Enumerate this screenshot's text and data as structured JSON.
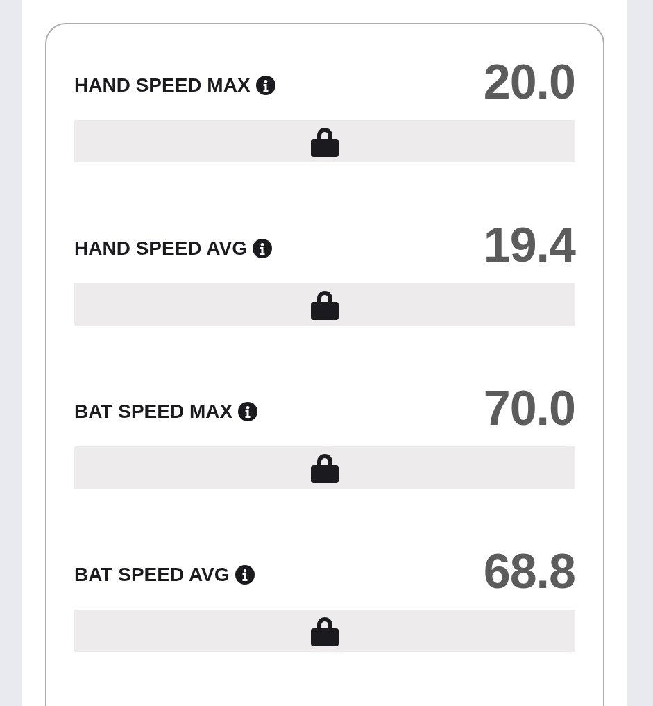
{
  "metrics": [
    {
      "label": "HAND SPEED MAX",
      "value": "20.0",
      "locked": true
    },
    {
      "label": "HAND SPEED AVG",
      "value": "19.4",
      "locked": true
    },
    {
      "label": "BAT SPEED MAX",
      "value": "70.0",
      "locked": true
    },
    {
      "label": "BAT SPEED AVG",
      "value": "68.8",
      "locked": true
    }
  ]
}
